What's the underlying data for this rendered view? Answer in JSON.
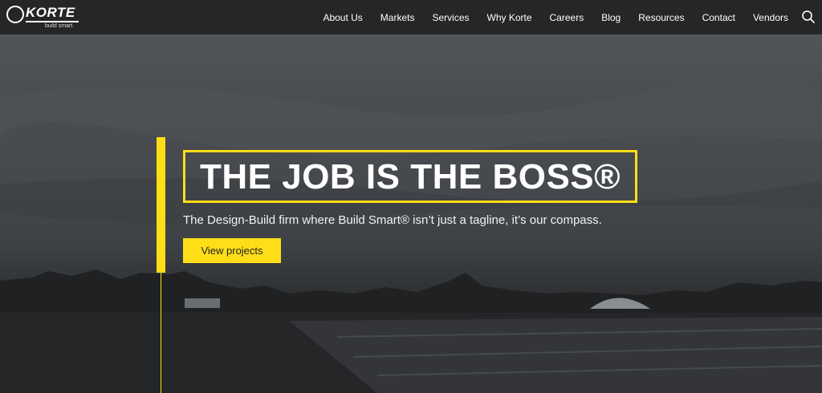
{
  "logo": {
    "name": "KORTE",
    "tagline": "build smart."
  },
  "nav": {
    "items": [
      "About Us",
      "Markets",
      "Services",
      "Why Korte",
      "Careers",
      "Blog",
      "Resources",
      "Contact",
      "Vendors"
    ],
    "search_icon": "search-icon"
  },
  "hero": {
    "headline": "THE JOB IS THE BOSS®",
    "subheadline": "The Design-Build firm where Build Smart® isn’t just a tagline, it’s our compass.",
    "cta_label": "View projects"
  },
  "colors": {
    "accent": "#ffde17",
    "topbar": "#252628",
    "text": "#ffffff"
  }
}
